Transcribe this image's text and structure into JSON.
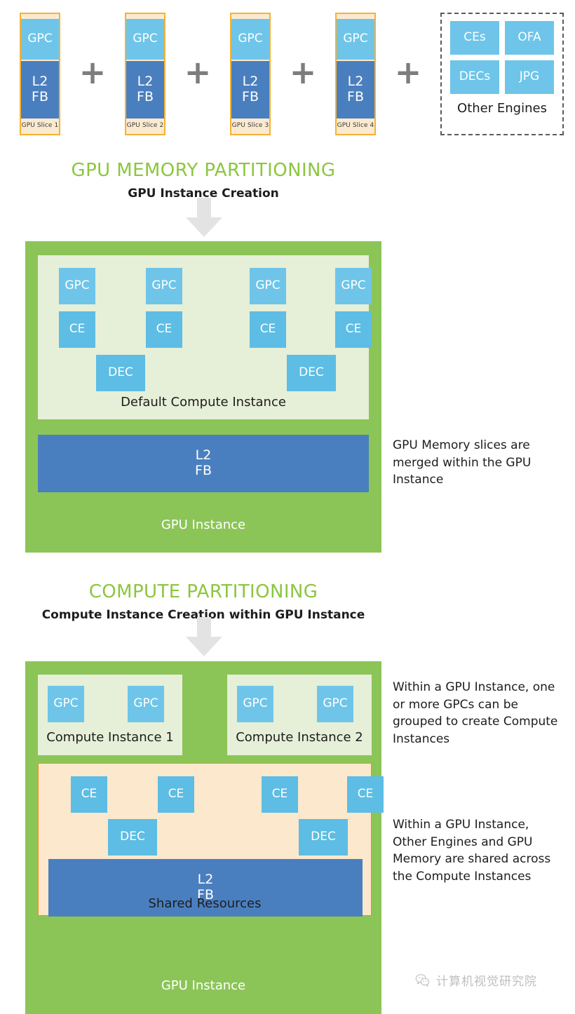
{
  "top_row": {
    "slices": [
      {
        "gpc": "GPC",
        "l2": "L2",
        "fb": "FB",
        "label": "GPU Slice 1"
      },
      {
        "gpc": "GPC",
        "l2": "L2",
        "fb": "FB",
        "label": "GPU Slice 2"
      },
      {
        "gpc": "GPC",
        "l2": "L2",
        "fb": "FB",
        "label": "GPU Slice 3"
      },
      {
        "gpc": "GPC",
        "l2": "L2",
        "fb": "FB",
        "label": "GPU Slice 4"
      }
    ],
    "plus": "+",
    "other_engines": {
      "engines": [
        "CEs",
        "OFA",
        "DECs",
        "JPG"
      ],
      "label": "Other Engines"
    }
  },
  "section_memory": {
    "title": "GPU MEMORY PARTITIONING",
    "subtitle": "GPU Instance Creation",
    "arrow": "arrow-down-icon"
  },
  "gpu_instance_panel": {
    "instance_label": "GPU Instance",
    "default_compute_instance": {
      "label": "Default Compute Instance",
      "gpcs": [
        "GPC",
        "GPC",
        "GPC",
        "GPC"
      ],
      "ces": [
        "CE",
        "CE",
        "CE",
        "CE"
      ],
      "decs": [
        "DEC",
        "DEC"
      ]
    },
    "memory": {
      "l2": "L2",
      "fb": "FB"
    },
    "note": "GPU Memory slices are merged within the GPU Instance"
  },
  "section_compute": {
    "title": "COMPUTE PARTITIONING",
    "subtitle": "Compute Instance Creation within GPU Instance",
    "arrow": "arrow-down-icon"
  },
  "compute_panel": {
    "instance_label": "GPU Instance",
    "compute_instances": [
      {
        "label": "Compute Instance 1",
        "gpcs": [
          "GPC",
          "GPC"
        ]
      },
      {
        "label": "Compute Instance 2",
        "gpcs": [
          "GPC",
          "GPC"
        ]
      }
    ],
    "shared_resources": {
      "label": "Shared Resources",
      "ces": [
        "CE",
        "CE",
        "CE",
        "CE"
      ],
      "decs": [
        "DEC",
        "DEC"
      ],
      "memory": {
        "l2": "L2",
        "fb": "FB"
      }
    },
    "note_top": "Within a GPU Instance, one or more GPCs can be grouped to create Compute Instances",
    "note_bottom": "Within a GPU Instance, Other Engines and GPU Memory are shared across the Compute Instances"
  },
  "watermark": {
    "icon": "wechat-icon",
    "text": "计算机视觉研究院"
  },
  "colors": {
    "gpc_blue": "#6ec5e9",
    "engine_blue": "#5dbde4",
    "memory_blue": "#4a7fbf",
    "slice_fill": "#fbeacf",
    "slice_border": "#f5b233",
    "green": "#8cc557",
    "light_green": "#e6efd8",
    "peach": "#fbe8cd",
    "peach_border": "#ef8f22",
    "title_green": "#8cc63f",
    "plus_gray": "#7d7d7d",
    "arrow_gray": "#e2e2e2"
  }
}
